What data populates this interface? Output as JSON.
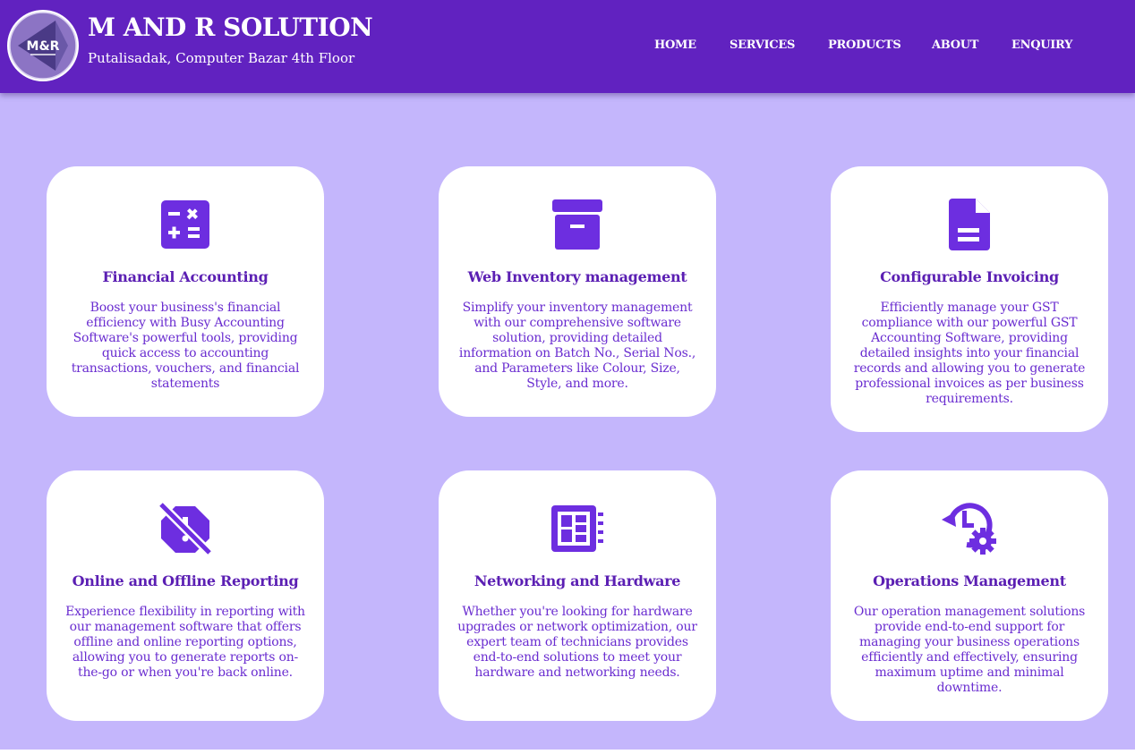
{
  "header": {
    "logo_text": "M&R",
    "title": "M AND R SOLUTION",
    "subtitle": "Putalisadak, Computer Bazar 4th Floor"
  },
  "nav": {
    "items": [
      "HOME",
      "SERVICES",
      "PRODUCTS",
      "ABOUT",
      "ENQUIRY"
    ]
  },
  "colors": {
    "header_bg": "#6122c0",
    "page_bg": "#c4b6fc",
    "card_bg": "#ffffff",
    "accent": "#6d2ee0"
  },
  "services": [
    {
      "icon": "calculator-icon",
      "title": "Financial Accounting",
      "description": "Boost your business's financial efficiency with Busy Accounting Software's powerful tools, providing quick access to accounting transactions, vouchers, and financial statements"
    },
    {
      "icon": "archive-box-icon",
      "title": "Web Inventory management",
      "description": "Simplify your inventory management with our comprehensive software solution, providing detailed information on Batch No., Serial Nos., and Parameters like Colour, Size, Style, and more."
    },
    {
      "icon": "document-icon",
      "title": "Configurable Invoicing",
      "description": "Efficiently manage your GST compliance with our powerful GST Accounting Software, providing detailed insights into your financial records and allowing you to generate professional invoices as per business requirements."
    },
    {
      "icon": "report-off-icon",
      "title": "Online and Offline Reporting",
      "description": "Experience flexibility in reporting with our management software that offers offline and online reporting options, allowing you to generate reports on-the-go or when you're back online."
    },
    {
      "icon": "hardware-board-icon",
      "title": "Networking and Hardware",
      "description": "Whether you're looking for hardware upgrades or network optimization, our expert team of technicians provides end-to-end solutions to meet your hardware and networking needs."
    },
    {
      "icon": "clock-settings-icon",
      "title": "Operations Management",
      "description": "Our operation management solutions provide end-to-end support for managing your business operations efficiently and effectively, ensuring maximum uptime and minimal downtime."
    }
  ]
}
